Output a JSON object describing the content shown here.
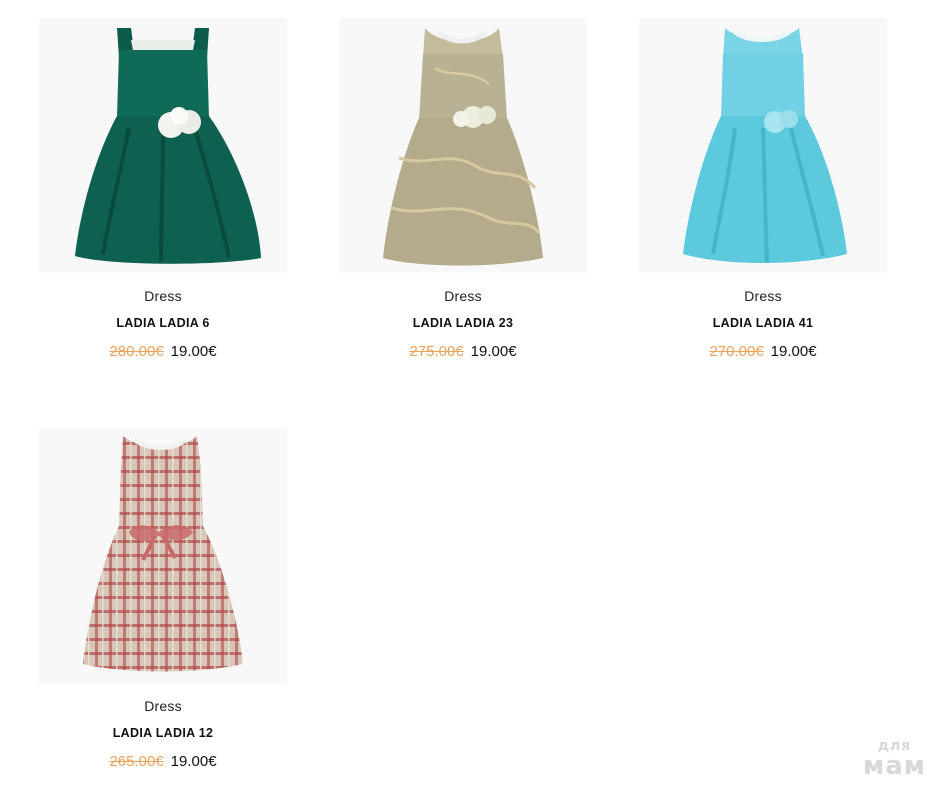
{
  "products": [
    {
      "category": "Dress",
      "title": "LADIA LADIA 6",
      "old_price": "280.00€",
      "price": "19.00€",
      "image_icon": "green-dress-image",
      "color": "#0f6a57"
    },
    {
      "category": "Dress",
      "title": "LADIA LADIA 23",
      "old_price": "275.00€",
      "price": "19.00€",
      "image_icon": "gold-brocade-dress-image",
      "color": "#b8ae8e"
    },
    {
      "category": "Dress",
      "title": "LADIA LADIA 41",
      "old_price": "270.00€",
      "price": "19.00€",
      "image_icon": "turquoise-dress-image",
      "color": "#5cc9dc"
    },
    {
      "category": "Dress",
      "title": "LADIA LADIA 12",
      "old_price": "265.00€",
      "price": "19.00€",
      "image_icon": "plaid-dress-image",
      "color": "#c9a69a"
    }
  ],
  "colors": {
    "old_price": "#e8a25a",
    "text": "#111111"
  },
  "watermark": {
    "top": "для",
    "bottom": "мам"
  }
}
